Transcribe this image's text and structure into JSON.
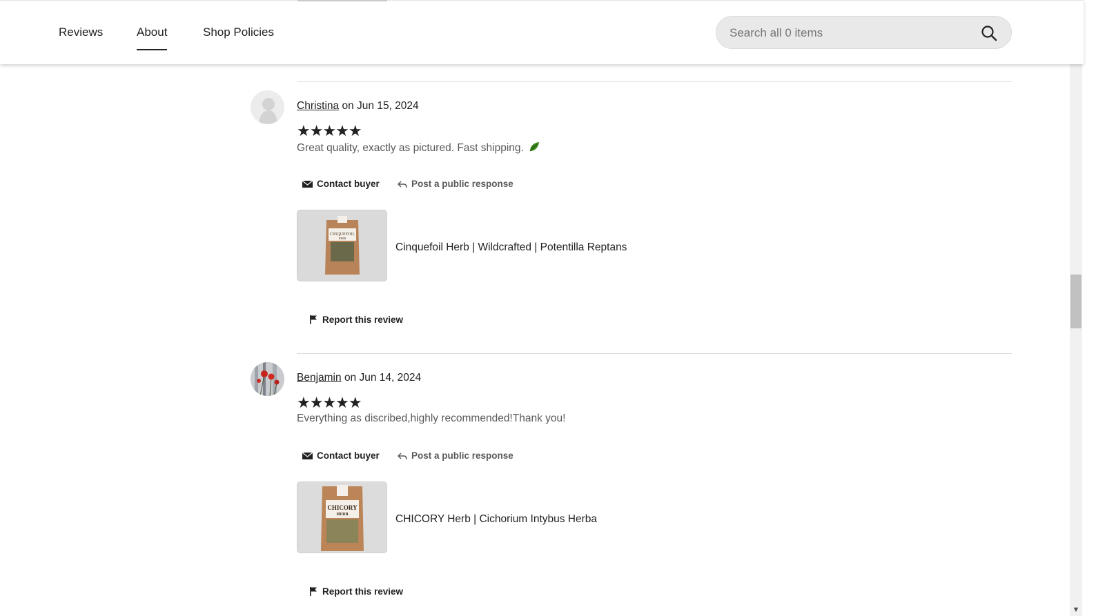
{
  "nav": {
    "tabs": [
      {
        "label": "Reviews"
      },
      {
        "label": "About"
      },
      {
        "label": "Shop Policies"
      }
    ],
    "active_tab": "About",
    "search_placeholder": "Search all 0 items"
  },
  "reviews": [
    {
      "buyer": "Christina",
      "date_text": "on Jun 15, 2024",
      "rating": 5,
      "stars": "★★★★★",
      "text": "Great quality, exactly as pictured. Fast shipping.",
      "emoji": "leaf-emoji",
      "contact_label": "Contact buyer",
      "response_label": "Post a public response",
      "product_title": "Cinquefoil Herb | Wildcrafted | Potentilla Reptans",
      "product_label": "CINQUEFOIL",
      "product_sublabel": "HERB",
      "report_label": "Report this review"
    },
    {
      "buyer": "Benjamin",
      "date_text": "on Jun 14, 2024",
      "rating": 5,
      "stars": "★★★★★",
      "text": "Everything as discribed,highly recommended!Thank you!",
      "contact_label": "Contact buyer",
      "response_label": "Post a public response",
      "product_title": "CHICORY Herb | Cichorium Intybus Herba",
      "product_label": "CHICORY",
      "product_sublabel": "HERB",
      "report_label": "Report this review"
    }
  ],
  "colors": {
    "text": "#222222",
    "muted_text": "#595959",
    "search_bg": "#e9e9e9",
    "divider": "#dedede"
  }
}
